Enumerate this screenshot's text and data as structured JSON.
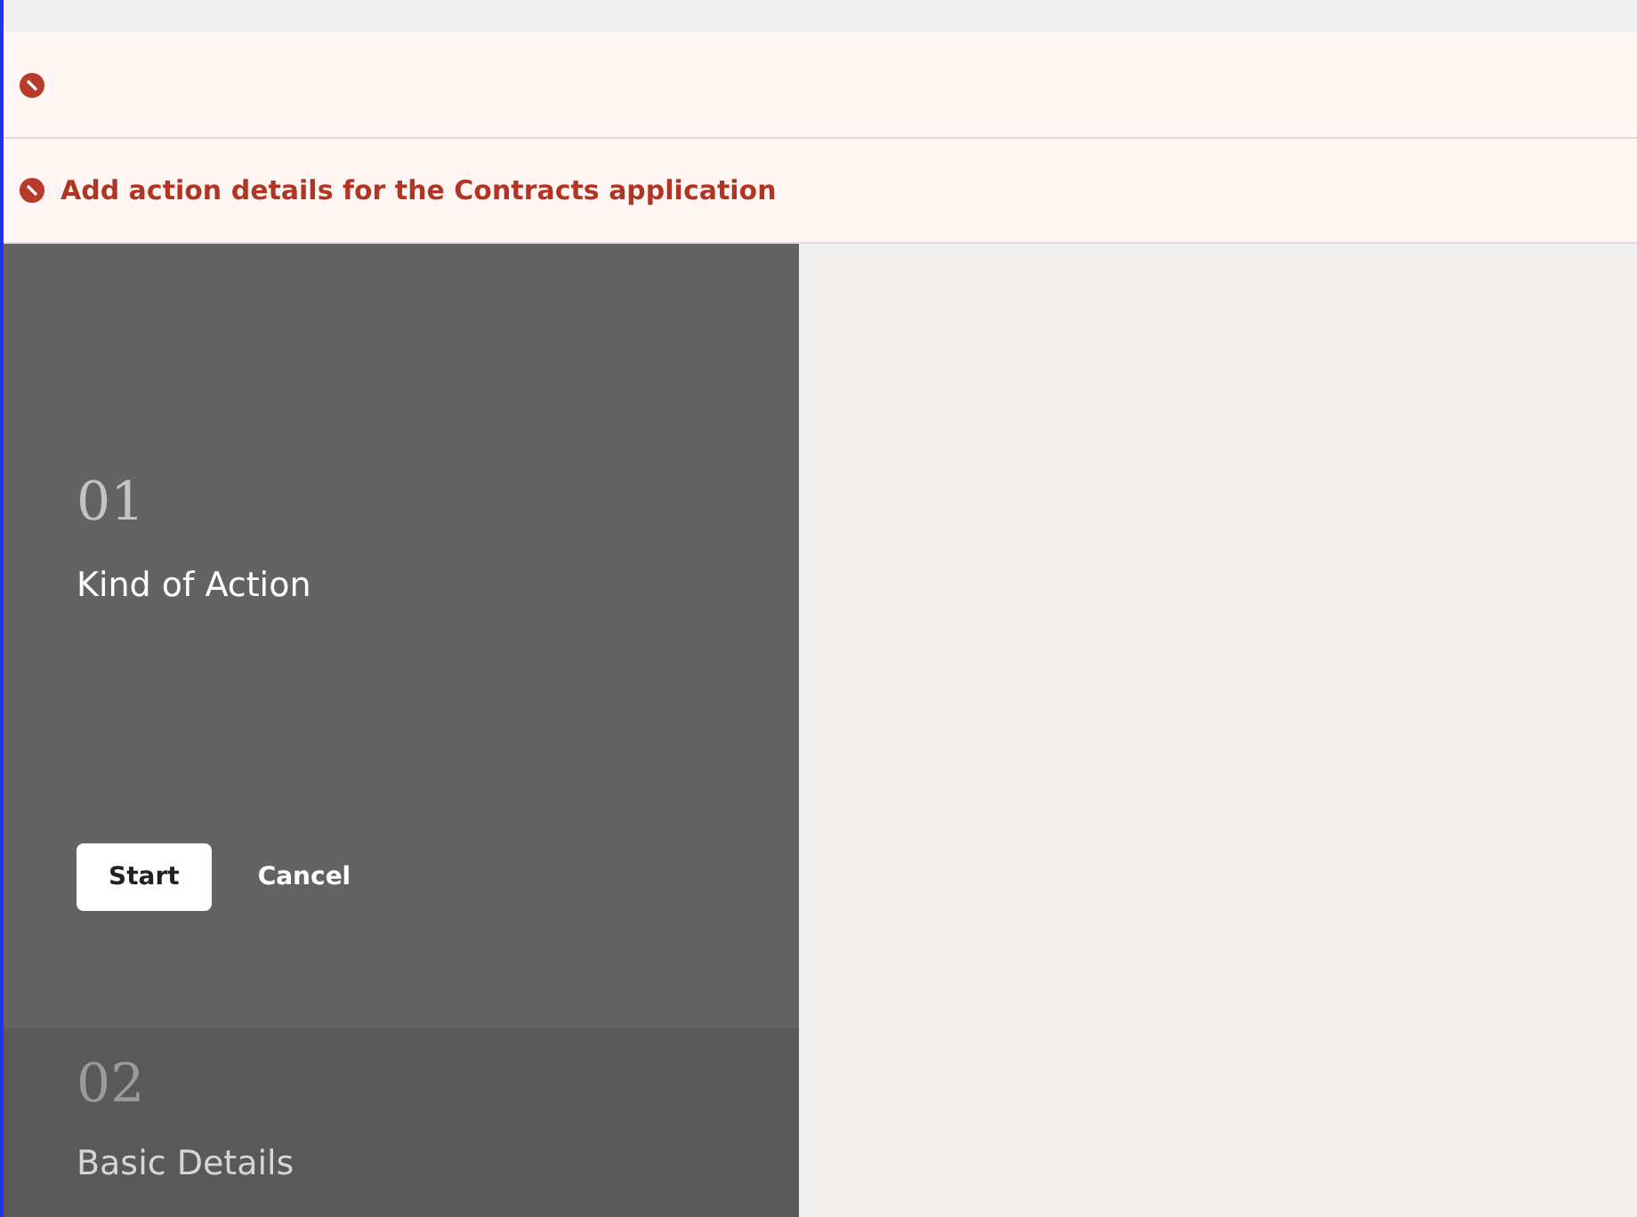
{
  "messages": [
    {
      "kind": "error"
    },
    {
      "kind": "error",
      "text": "Add action details for the Contracts application"
    }
  ],
  "steps": [
    {
      "number": "01",
      "title": "Kind of Action",
      "selected": true,
      "buttons": [
        {
          "label": "Start",
          "kind": "primary"
        },
        {
          "label": "Cancel",
          "kind": "link"
        }
      ]
    },
    {
      "number": "02",
      "title": "Basic Details",
      "selected": false
    }
  ]
}
